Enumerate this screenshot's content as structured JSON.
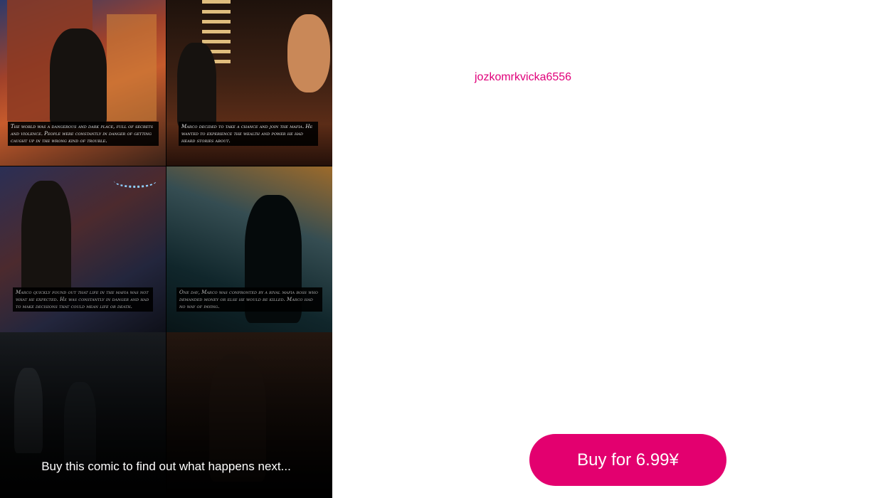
{
  "comic": {
    "captions": [
      "The world was a dangerous and dark place, full of secrets and violence. People were constantly in danger of getting caught up in the wrong kind of trouble.",
      "Marco decided to take a chance and join the mafia. He wanted to experience the wealth and power he had heard stories about.",
      "Marco quickly found out that life in the mafia was not what he expected. He was constantly in danger and had to make decisions that could mean life or death.",
      "One day, Marco was confronted by a rival mafia boss who demanded money or else he would be killed. Marco had no way of paying."
    ],
    "teaser": "Buy this comic to find out what happens next..."
  },
  "author": {
    "username": "jozkomrkvicka6556"
  },
  "purchase": {
    "label": "Buy for 6.99¥"
  },
  "colors": {
    "accent": "#e3006f",
    "link": "#e0007a",
    "panel_bg": "#000000"
  }
}
